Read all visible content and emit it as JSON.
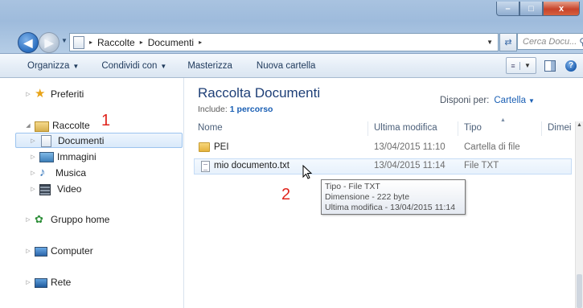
{
  "window": {
    "buttons": {
      "minimize": "–",
      "maximize": "□",
      "close": "x"
    }
  },
  "addressbar": {
    "crumbs": [
      "Raccolte",
      "Documenti"
    ],
    "separator": "▸",
    "search_placeholder": "Cerca Docu..."
  },
  "toolbar": {
    "items": [
      {
        "label": "Organizza",
        "dropdown": true
      },
      {
        "label": "Condividi con",
        "dropdown": true
      },
      {
        "label": "Masterizza",
        "dropdown": false
      },
      {
        "label": "Nuova cartella",
        "dropdown": false
      }
    ],
    "help": "?"
  },
  "nav": {
    "favorites": "Preferiti",
    "libraries": "Raccolte",
    "library_items": [
      "Documenti",
      "Immagini",
      "Musica",
      "Video"
    ],
    "homegroup": "Gruppo home",
    "computer": "Computer",
    "network": "Rete"
  },
  "annotations": {
    "one": "1",
    "two": "2"
  },
  "library": {
    "title": "Raccolta Documenti",
    "include_label": "Include:",
    "include_link": "1 percorso",
    "arrange_label": "Disponi per:",
    "arrange_value": "Cartella"
  },
  "columns": [
    "Nome",
    "Ultima modifica",
    "Tipo",
    "Dimei"
  ],
  "files": [
    {
      "name": "PEI",
      "modified": "13/04/2015 11:10",
      "type": "Cartella di file",
      "icon": "folder-icon"
    },
    {
      "name": "mio documento.txt",
      "modified": "13/04/2015 11:14",
      "type": "File TXT",
      "icon": "text-file-icon"
    }
  ],
  "tooltip": {
    "line1": "Tipo - File TXT",
    "line2": "Dimensione - 222 byte",
    "line3": "Ultima modifica - 13/04/2015 11:14"
  },
  "colors": {
    "title_blue": "#1e3f77",
    "link_blue": "#1a5fb4",
    "annotation_red": "#e0241c"
  }
}
